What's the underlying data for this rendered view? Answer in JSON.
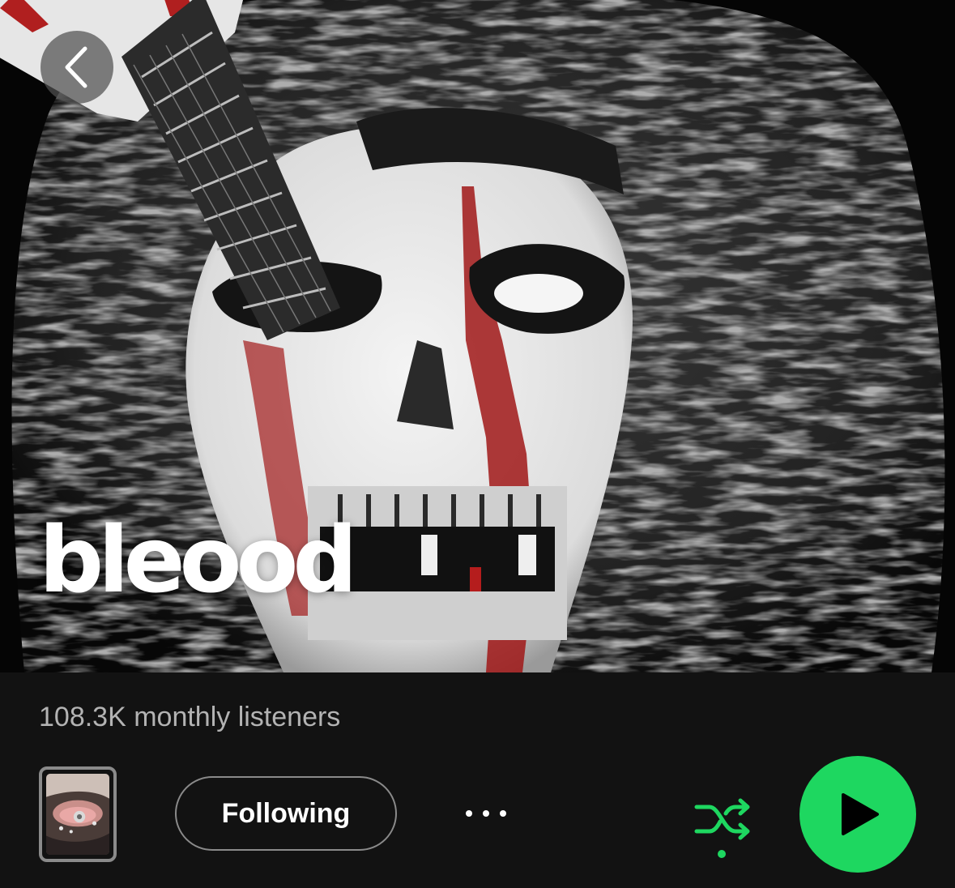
{
  "artist": {
    "name": "bleood",
    "monthly_listeners": "108.3K monthly listeners"
  },
  "actions": {
    "follow_label": "Following",
    "more_icon": "more-horizontal-icon",
    "shuffle_icon": "shuffle-icon",
    "play_icon": "play-icon",
    "back_icon": "chevron-left-icon"
  },
  "colors": {
    "background": "#121212",
    "accent": "#1ed760",
    "secondary_text": "#b3b3b3"
  }
}
